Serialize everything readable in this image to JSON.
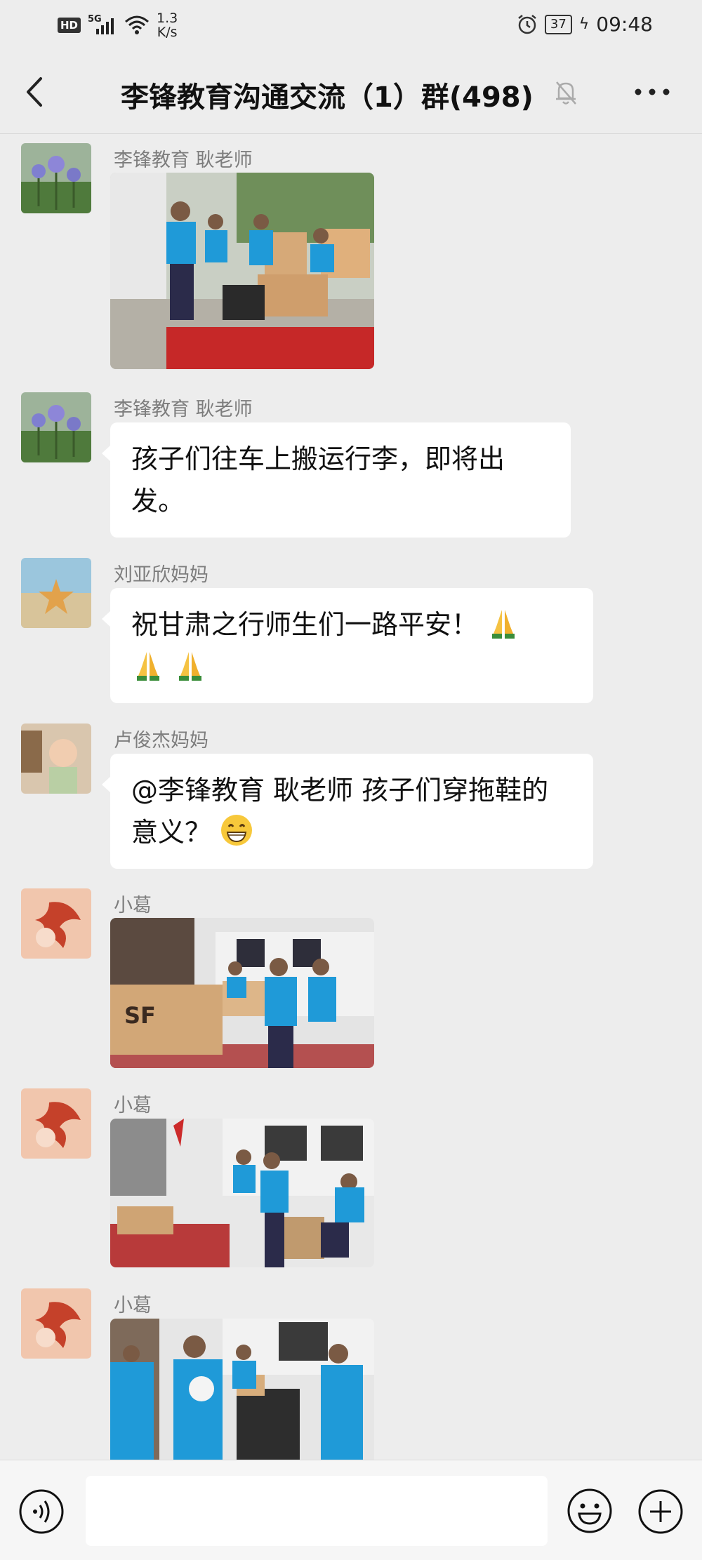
{
  "status_bar": {
    "hd": "HD",
    "network": "5G",
    "speed_value": "1.3",
    "speed_unit": "K/s",
    "battery": "37",
    "time": "09:48"
  },
  "nav": {
    "title": "李锋教育沟通交流（1）群(498)"
  },
  "messages": [
    {
      "sender": "李锋教育 耿老师",
      "type": "image"
    },
    {
      "sender": "李锋教育 耿老师",
      "type": "text",
      "text": "孩子们往车上搬运行李，即将出发。"
    },
    {
      "sender": "刘亚欣妈妈",
      "type": "text",
      "text": "祝甘肃之行师生们一路平安！"
    },
    {
      "sender": "卢俊杰妈妈",
      "type": "text",
      "text": "@李锋教育 耿老师  孩子们穿拖鞋的意义？"
    },
    {
      "sender": "小葛",
      "type": "image"
    },
    {
      "sender": "小葛",
      "type": "image"
    },
    {
      "sender": "小葛",
      "type": "image"
    }
  ],
  "icons": {
    "back": "chevron-left-icon",
    "mute": "bell-off-icon",
    "more": "more-dots-icon",
    "voice": "voice-input-icon",
    "emoji": "emoji-icon",
    "plus": "plus-circle-icon"
  },
  "colors": {
    "background": "#ededed",
    "bubble": "#ffffff",
    "sender_name": "#7d7d7d",
    "shirt_blue": "#1f9ad8"
  }
}
